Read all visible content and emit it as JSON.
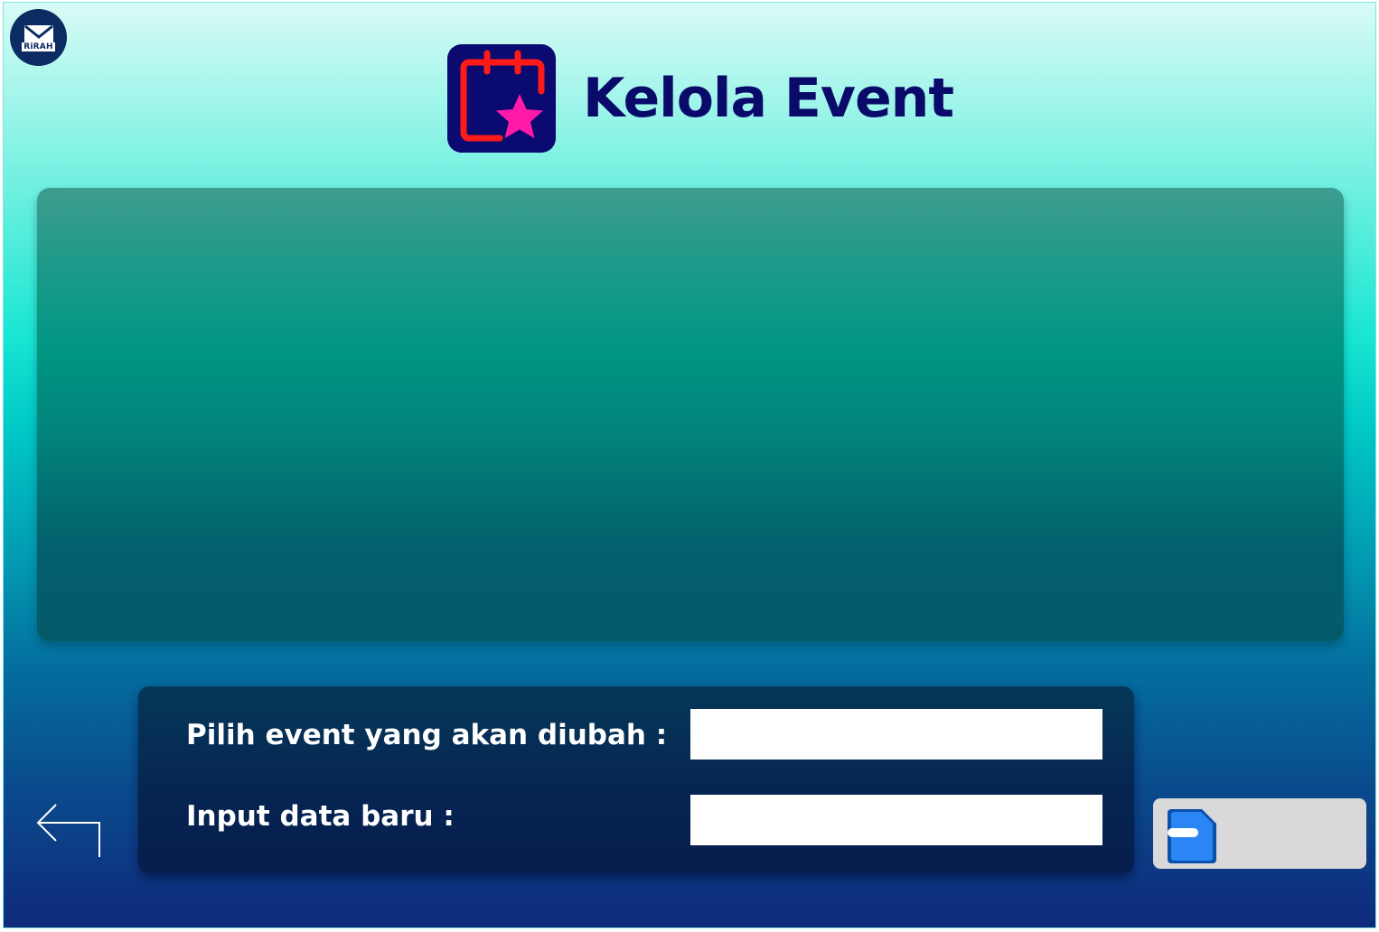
{
  "app": {
    "logo_text": "RiRAH",
    "logo_icon": "mail-icon"
  },
  "header": {
    "title": "Kelola Event",
    "icon": "calendar-star-icon"
  },
  "form": {
    "select_event_label": "Pilih event yang akan diubah :",
    "select_event_value": "",
    "new_data_label": "Input data baru :",
    "new_data_value": ""
  },
  "buttons": {
    "back_icon": "back-arrow-icon",
    "save_icon": "save-file-icon",
    "save_label": ""
  },
  "colors": {
    "title": "#0a0a6b",
    "icon_background": "#0a0a70",
    "calendar_outline": "#ff1a1a",
    "star": "#ff1aa8",
    "save_icon": "#1f7df0",
    "save_button_bg": "#d9d9d9"
  }
}
